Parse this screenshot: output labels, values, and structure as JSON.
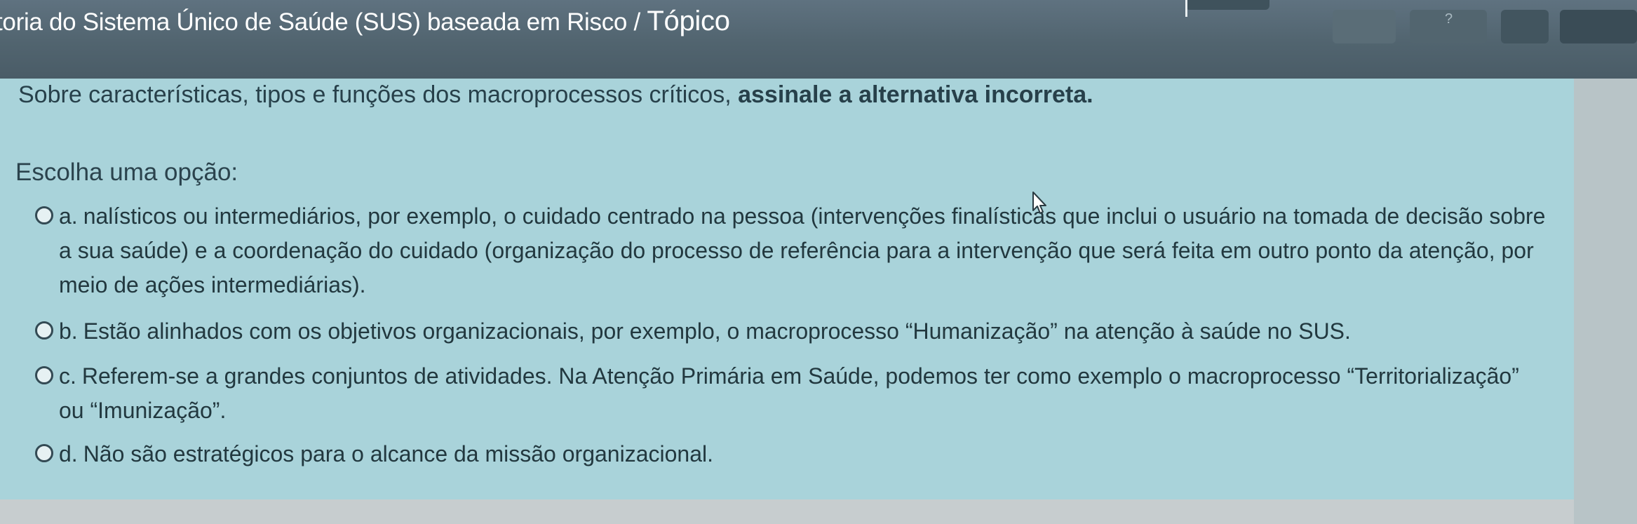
{
  "header": {
    "breadcrumb_text": "toria do Sistema Único de Saúde (SUS) baseada em Risco / ",
    "topic_label": "Tópico"
  },
  "question": {
    "text_normal": "Sobre características, tipos e funções dos macroprocessos críticos, ",
    "text_bold": "assinale a alternativa incorreta."
  },
  "choose_label": "Escolha uma opção:",
  "options": [
    {
      "letter": "a.",
      "text": "nalísticos ou intermediários, por exemplo, o cuidado centrado na pessoa (intervenções finalísticas que inclui o usuário na tomada de decisão sobre a sua saúde) e a coordenação do cuidado (organização do processo de referência para a intervenção que será feita em outro ponto da atenção, por meio de ações intermediárias)."
    },
    {
      "letter": "b.",
      "text": "Estão alinhados com os objetivos organizacionais, por exemplo, o macroprocesso “Humanização” na atenção à saúde no SUS."
    },
    {
      "letter": "c.",
      "text": "Referem-se a grandes conjuntos de atividades. Na Atenção Primária em Saúde, podemos ter como exemplo o macroprocesso “Territorialização” ou “Imunização”."
    },
    {
      "letter": "d.",
      "text": "Não são estratégicos para o alcance da missão organizacional."
    }
  ],
  "colors": {
    "panel_bg": "#a9d3da",
    "header_bg": "#51646f",
    "text": "#22383f"
  },
  "icons": {
    "cursor": "mouse-pointer-icon",
    "radio": "radio-unchecked-icon",
    "help": "question-icon"
  }
}
